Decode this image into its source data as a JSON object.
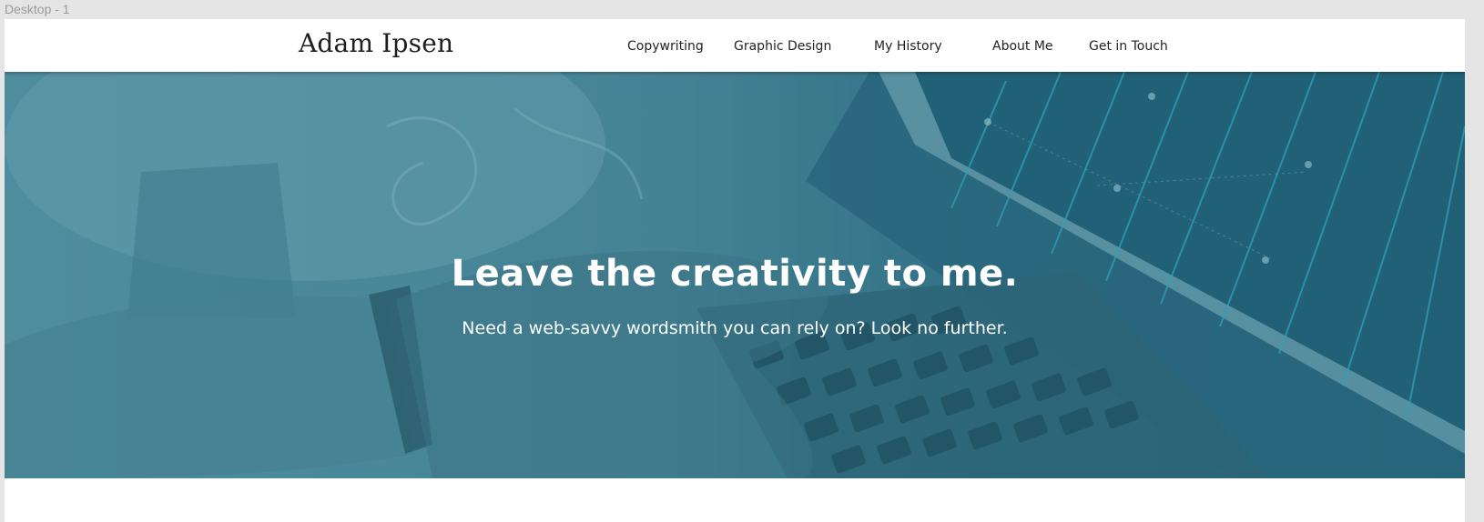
{
  "artboard": {
    "label": "Desktop - 1"
  },
  "header": {
    "logo": "Adam Ipsen",
    "nav": [
      {
        "label": "Copywriting"
      },
      {
        "label": "Graphic Design"
      },
      {
        "label": "My History"
      },
      {
        "label": "About Me"
      },
      {
        "label": "Get in Touch"
      }
    ]
  },
  "hero": {
    "title": "Leave the creativity to me.",
    "subtitle": "Need a web-savvy wordsmith you can rely on? Look no further.",
    "overlay_color": "#2f7286",
    "background_image": "laptop-typing-photo"
  },
  "colors": {
    "nav_text": "#222222",
    "hero_text": "#ffffff",
    "artboard_bg": "#e5e5e5"
  }
}
